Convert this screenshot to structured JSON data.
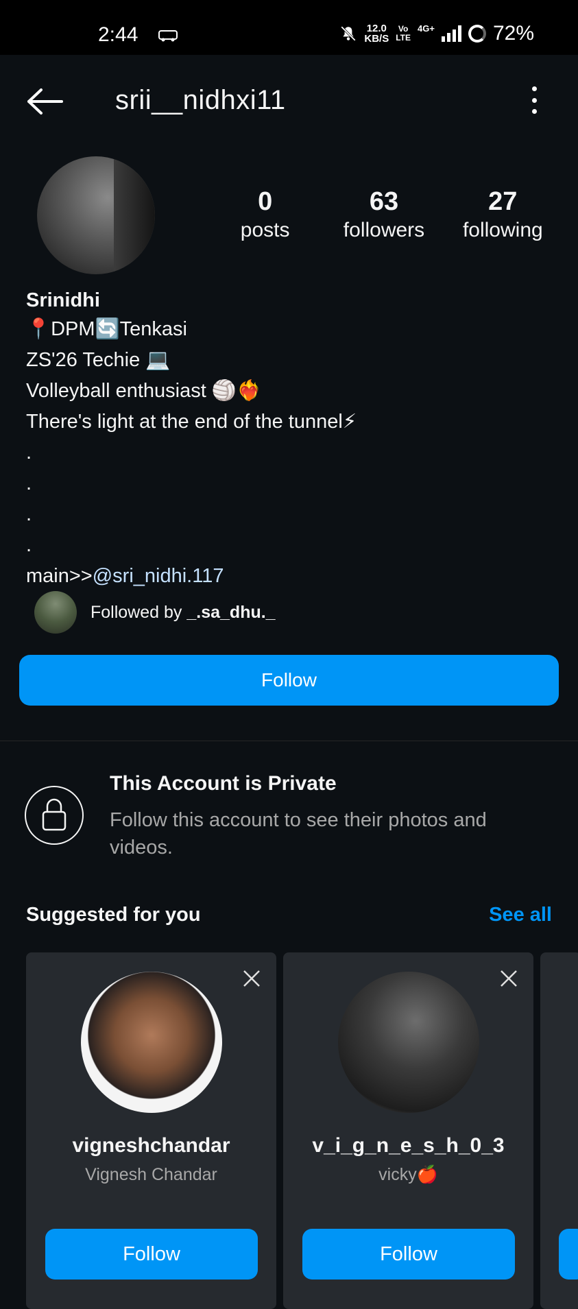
{
  "status_bar": {
    "time": "2:44",
    "net_speed": "12.0",
    "net_unit": "KB/S",
    "volte_top": "Vo",
    "volte_bottom": "LTE",
    "network": "4G+",
    "battery": "72%"
  },
  "header": {
    "username": "srii__nidhxi11"
  },
  "stats": [
    {
      "value": "0",
      "label": "posts"
    },
    {
      "value": "63",
      "label": "followers"
    },
    {
      "value": "27",
      "label": "following"
    }
  ],
  "bio": {
    "name": "Srinidhi",
    "lines": [
      "📍DPM🔄Tenkasi",
      "ZS'26 Techie 💻",
      "Volleyball enthusiast 🏐❤️‍🔥",
      "There's light at the end of the tunnel⚡",
      ".",
      ".",
      ".",
      "."
    ],
    "main_prefix": "main>>",
    "main_mention": "@sri_nidhi.117"
  },
  "followed_by": {
    "prefix": "Followed by ",
    "user": "_.sa_dhu._"
  },
  "follow_button": "Follow",
  "private": {
    "title": "This Account is Private",
    "description": "Follow this account to see their photos and videos."
  },
  "suggested": {
    "title": "Suggested for you",
    "see_all": "See all",
    "cards": [
      {
        "username": "vigneshchandar",
        "full_name": "Vignesh Chandar",
        "button": "Follow"
      },
      {
        "username": "v_i_g_n_e_s_h_0_3",
        "full_name": "vicky🍎",
        "button": "Follow"
      }
    ]
  }
}
